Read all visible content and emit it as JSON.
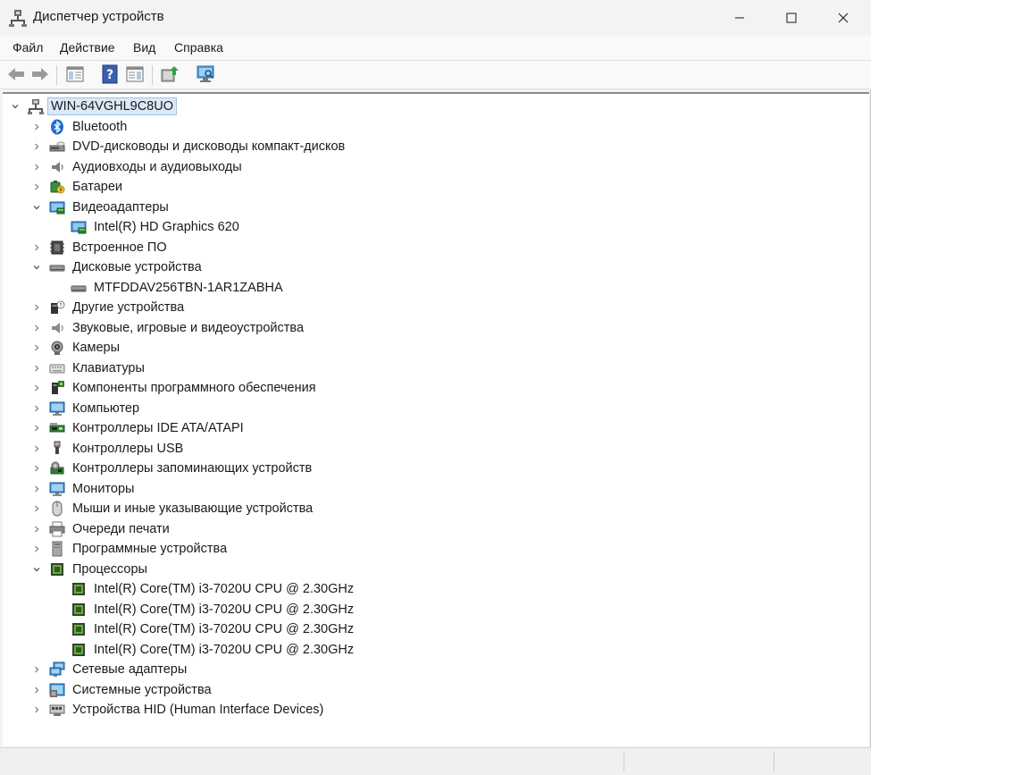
{
  "window": {
    "title": "Диспетчер устройств"
  },
  "menu": [
    "Файл",
    "Действие",
    "Вид",
    "Справка"
  ],
  "toolbar": {
    "buttons": [
      "back-icon",
      "forward-icon",
      "properties-pane-icon",
      "help-icon",
      "view-pane-icon",
      "update-driver-icon",
      "scan-hardware-icon"
    ]
  },
  "tree": {
    "root": {
      "label": "WIN-64VGHL9C8UO",
      "icon": "computer-network-icon"
    },
    "items": [
      {
        "label": "Bluetooth",
        "icon": "bluetooth-icon",
        "state": "collapsed",
        "children": []
      },
      {
        "label": "DVD-дисководы и дисководы компакт-дисков",
        "icon": "dvd-drive-icon",
        "state": "collapsed",
        "children": []
      },
      {
        "label": "Аудиовходы и аудиовыходы",
        "icon": "speaker-icon",
        "state": "collapsed",
        "children": []
      },
      {
        "label": "Батареи",
        "icon": "battery-icon",
        "state": "collapsed",
        "children": []
      },
      {
        "label": "Видеоадаптеры",
        "icon": "display-adapter-icon",
        "state": "expanded",
        "children": [
          {
            "label": "Intel(R) HD Graphics 620",
            "icon": "display-adapter-icon"
          }
        ]
      },
      {
        "label": "Встроенное ПО",
        "icon": "firmware-icon",
        "state": "collapsed",
        "children": []
      },
      {
        "label": "Дисковые устройства",
        "icon": "disk-drive-icon",
        "state": "expanded",
        "children": [
          {
            "label": "MTFDDAV256TBN-1AR1ZABHA",
            "icon": "disk-drive-icon"
          }
        ]
      },
      {
        "label": "Другие устройства",
        "icon": "unknown-device-icon",
        "state": "collapsed",
        "children": []
      },
      {
        "label": "Звуковые, игровые и видеоустройства",
        "icon": "sound-device-icon",
        "state": "collapsed",
        "children": []
      },
      {
        "label": "Камеры",
        "icon": "camera-icon",
        "state": "collapsed",
        "children": []
      },
      {
        "label": "Клавиатуры",
        "icon": "keyboard-icon",
        "state": "collapsed",
        "children": []
      },
      {
        "label": "Компоненты программного обеспечения",
        "icon": "software-component-icon",
        "state": "collapsed",
        "children": []
      },
      {
        "label": "Компьютер",
        "icon": "computer-icon",
        "state": "collapsed",
        "children": []
      },
      {
        "label": "Контроллеры IDE ATA/ATAPI",
        "icon": "ide-controller-icon",
        "state": "collapsed",
        "children": []
      },
      {
        "label": "Контроллеры USB",
        "icon": "usb-icon",
        "state": "collapsed",
        "children": []
      },
      {
        "label": "Контроллеры запоминающих устройств",
        "icon": "storage-controller-icon",
        "state": "collapsed",
        "children": []
      },
      {
        "label": "Мониторы",
        "icon": "monitor-icon",
        "state": "collapsed",
        "children": []
      },
      {
        "label": "Мыши и иные указывающие устройства",
        "icon": "mouse-icon",
        "state": "collapsed",
        "children": []
      },
      {
        "label": "Очереди печати",
        "icon": "printer-icon",
        "state": "collapsed",
        "children": []
      },
      {
        "label": "Программные устройства",
        "icon": "software-device-icon",
        "state": "collapsed",
        "children": []
      },
      {
        "label": "Процессоры",
        "icon": "processor-icon",
        "state": "expanded",
        "children": [
          {
            "label": "Intel(R) Core(TM) i3-7020U CPU @ 2.30GHz",
            "icon": "processor-icon"
          },
          {
            "label": "Intel(R) Core(TM) i3-7020U CPU @ 2.30GHz",
            "icon": "processor-icon"
          },
          {
            "label": "Intel(R) Core(TM) i3-7020U CPU @ 2.30GHz",
            "icon": "processor-icon"
          },
          {
            "label": "Intel(R) Core(TM) i3-7020U CPU @ 2.30GHz",
            "icon": "processor-icon"
          }
        ]
      },
      {
        "label": "Сетевые адаптеры",
        "icon": "network-adapter-icon",
        "state": "collapsed",
        "children": []
      },
      {
        "label": "Системные устройства",
        "icon": "system-device-icon",
        "state": "collapsed",
        "children": []
      },
      {
        "label": "Устройства HID (Human Interface Devices)",
        "icon": "hid-icon",
        "state": "collapsed",
        "children": []
      }
    ]
  }
}
